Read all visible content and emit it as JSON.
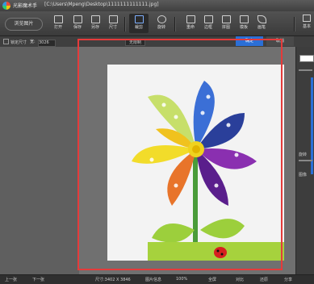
{
  "window": {
    "app_title": "光影魔术手",
    "file_path": "[C:\\Users\\Mpeng\\Desktop\\1111111111111.jpg]"
  },
  "toolbar": {
    "browse_label": "浏览图片",
    "tools": [
      {
        "label": "打开",
        "icon": "folder-open-icon"
      },
      {
        "label": "保存",
        "icon": "save-icon"
      },
      {
        "label": "另存",
        "icon": "save-as-icon"
      },
      {
        "label": "尺寸",
        "icon": "resize-icon"
      },
      {
        "label": "裁剪",
        "icon": "crop-icon"
      },
      {
        "label": "旋转",
        "icon": "rotate-icon"
      },
      {
        "label": "重命",
        "icon": "rename-icon"
      },
      {
        "label": "边框",
        "icon": "frame-icon"
      },
      {
        "label": "拼图",
        "icon": "collage-icon"
      },
      {
        "label": "模板",
        "icon": "template-icon"
      },
      {
        "label": "画笔",
        "icon": "brush-icon"
      }
    ],
    "right_tab": "基本"
  },
  "crop_options": {
    "lock_ratio_label": "锁定尺寸",
    "width_label": "宽:",
    "width_value": "3026",
    "ratio_label": "无限制",
    "apply_label": "确定",
    "cancel_label": "取消"
  },
  "side_panel": {
    "rotate_label": "旋转",
    "label2": "图像"
  },
  "statusbar": {
    "prev": "上一张",
    "next": "下一张",
    "size": "尺寸:3402 X 3846",
    "info": "图片信息",
    "zoom": "100%",
    "fullscreen": "全屏",
    "compare": "对比",
    "restore": "还原",
    "share": "分享"
  }
}
